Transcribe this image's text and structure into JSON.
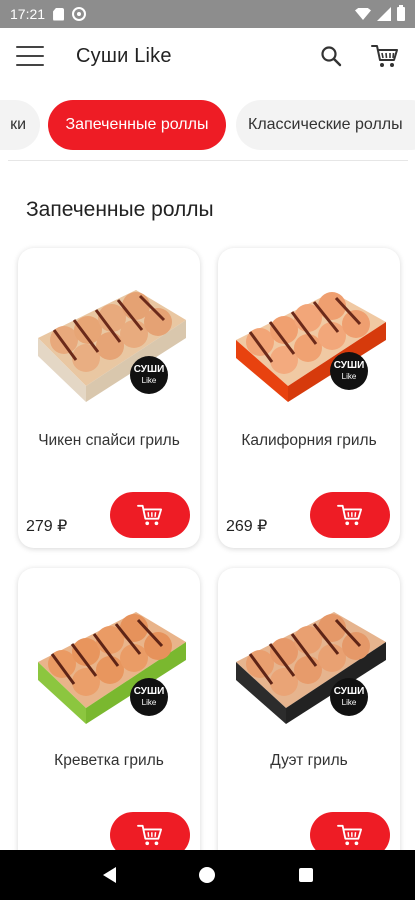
{
  "status_bar": {
    "time": "17:21"
  },
  "app_bar": {
    "title": "Суши Like"
  },
  "categories": {
    "previous": "ки",
    "active": "Запеченные роллы",
    "next": "Классические роллы"
  },
  "section": {
    "title": "Запеченные роллы"
  },
  "brand": {
    "badge_line1": "СУШИ",
    "badge_line2": "Like"
  },
  "products": [
    {
      "name": "Чикен спайси гриль",
      "price": "279 ₽"
    },
    {
      "name": "Калифорния гриль",
      "price": "269 ₽"
    },
    {
      "name": "Креветка гриль"
    },
    {
      "name": "Дуэт гриль"
    }
  ],
  "colors": {
    "accent": "#ee1c25",
    "status_bar": "#8d8d8d",
    "nav_bar": "#000000"
  },
  "icons": {
    "menu": "menu-icon",
    "search": "search-icon",
    "cart": "cart-icon",
    "add_to_cart": "cart-icon",
    "back": "back-icon",
    "home": "home-icon",
    "recents": "recents-icon"
  }
}
